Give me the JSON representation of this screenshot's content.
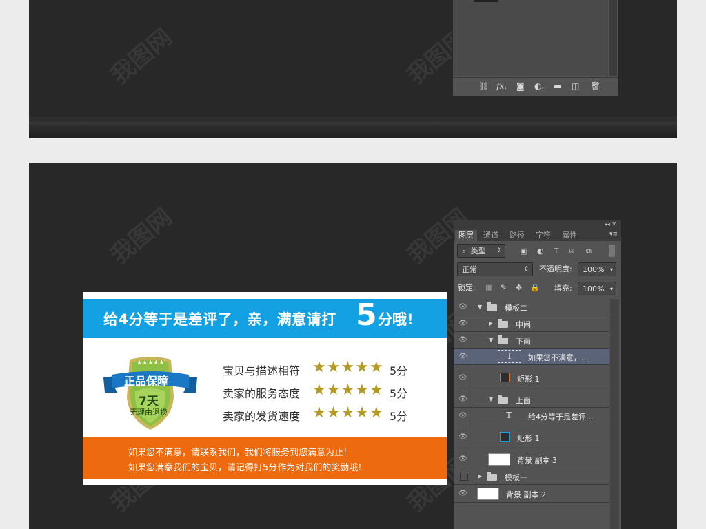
{
  "top_panel": {
    "footer_icons": [
      "link-icon",
      "fx-icon",
      "mask-icon",
      "adjustment-icon",
      "folder-icon",
      "new-layer-icon",
      "trash-icon"
    ]
  },
  "card": {
    "banner_prefix": "给4分等于是差评了，亲，满意请打",
    "banner_big": "5",
    "banner_suffix": "分哦!",
    "badge": {
      "stars": "★★★★★",
      "title": "正品保障",
      "days": "7天",
      "subtitle": "无理由退换"
    },
    "ratings": [
      {
        "label": "宝贝与描述相符",
        "stars": "★★★★★",
        "score": "5分"
      },
      {
        "label": "卖家的服务态度",
        "stars": "★★★★★",
        "score": "5分"
      },
      {
        "label": "卖家的发货速度",
        "stars": "★★★★★",
        "score": "5分"
      }
    ],
    "footer_lines": [
      "如果您不满意，请联系我们，我们将服务到您满意为止!",
      "如果您满意我们的宝贝，请记得打5分作为对我们的奖励哦!"
    ],
    "colors": {
      "banner": "#13a1e3",
      "footer": "#ee6a0f",
      "stars": "#b39a25",
      "badge_ribbon": "#1b78c4",
      "badge_shield": "#8dc043"
    }
  },
  "ps_panel": {
    "topbar_glyph": "◂◂ ✕",
    "tabs": [
      "图层",
      "通道",
      "路径",
      "字符",
      "属性"
    ],
    "filter_label": "类型",
    "filter_glyph": "⌕",
    "blend_mode": "正常",
    "opacity_label": "不透明度:",
    "opacity_value": "100%",
    "lock_label": "锁定:",
    "fill_label": "填充:",
    "fill_value": "100%",
    "layers": [
      {
        "name": "模板二",
        "type": "group",
        "expanded": true,
        "visible": true
      },
      {
        "name": "中间",
        "type": "group",
        "expanded": false,
        "visible": true
      },
      {
        "name": "下面",
        "type": "group",
        "expanded": true,
        "visible": true
      },
      {
        "name": "如果您不满意，...",
        "type": "text",
        "visible": true,
        "selected": true
      },
      {
        "name": "矩形 1",
        "type": "shape",
        "visible": true
      },
      {
        "name": "上面",
        "type": "group",
        "expanded": true,
        "visible": true
      },
      {
        "name": "给4分等于是差评...",
        "type": "text",
        "visible": true
      },
      {
        "name": "矩形 1",
        "type": "shape",
        "visible": true
      },
      {
        "name": "背景 副本 3",
        "type": "image",
        "visible": true
      },
      {
        "name": "模板一",
        "type": "group",
        "expanded": false,
        "visible": false
      },
      {
        "name": "背景 副本 2",
        "type": "image",
        "visible": true
      }
    ]
  }
}
